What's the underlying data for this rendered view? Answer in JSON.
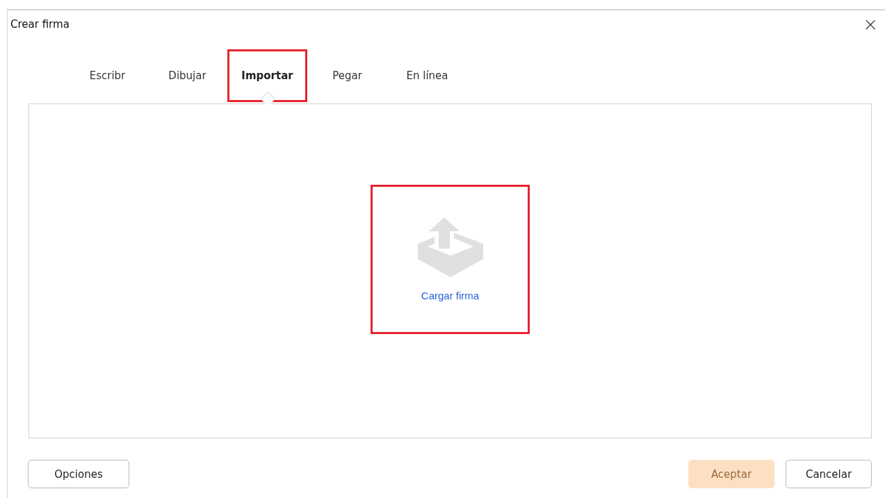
{
  "window": {
    "title": "Crear firma",
    "close": "×"
  },
  "tabs": [
    {
      "label": "Escribr",
      "selected": false,
      "highlighted": false
    },
    {
      "label": "Dibujar",
      "selected": false,
      "highlighted": false
    },
    {
      "label": "Importar",
      "selected": true,
      "highlighted": true
    },
    {
      "label": "Pegar",
      "selected": false,
      "highlighted": false
    },
    {
      "label": "En línea",
      "selected": false,
      "highlighted": false
    }
  ],
  "upload": {
    "label": "Cargar firma",
    "highlighted": true
  },
  "buttons": [
    {
      "label": "Opciones",
      "disabled": false,
      "kind": "secondary"
    },
    {
      "label": "Aceptar",
      "disabled": true,
      "kind": "primary"
    },
    {
      "label": "Cancelar",
      "disabled": false,
      "kind": "secondary"
    }
  ]
}
